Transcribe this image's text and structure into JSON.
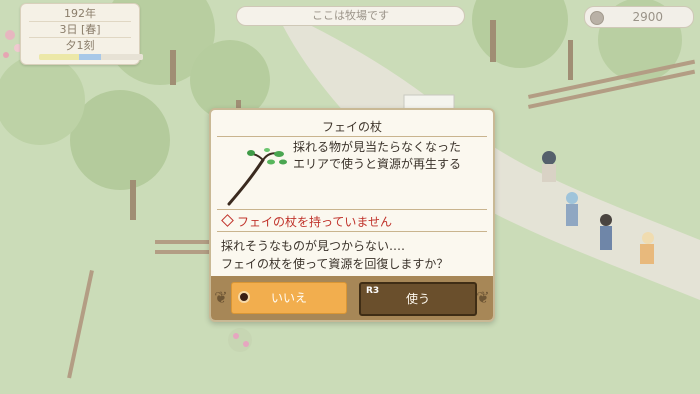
{
  "hud": {
    "year": "192年",
    "day": "3日 [春]",
    "time": "夕1刻",
    "location": "ここは牧場です",
    "money": "2900",
    "coin_icon": "coin-icon"
  },
  "dialog": {
    "title": "フェイの杖",
    "item_icon": "fairy-staff-icon",
    "description": [
      "採れる物が見当たらなくなった",
      "エリアで使うと資源が再生する"
    ],
    "warning": "フェイの杖を持っていません",
    "prompt": [
      "採れそうなものが見つからない‥‥",
      "フェイの杖を使って資源を回復しますか？"
    ],
    "buttons": {
      "no_label": "いいえ",
      "no_icon": "circle-button-icon",
      "yes_label": "使う",
      "yes_hint": "R3"
    }
  },
  "colors": {
    "warning": "#c0332b",
    "button_selected": "#f2ae4e",
    "button_other": "#6a4f2c"
  }
}
